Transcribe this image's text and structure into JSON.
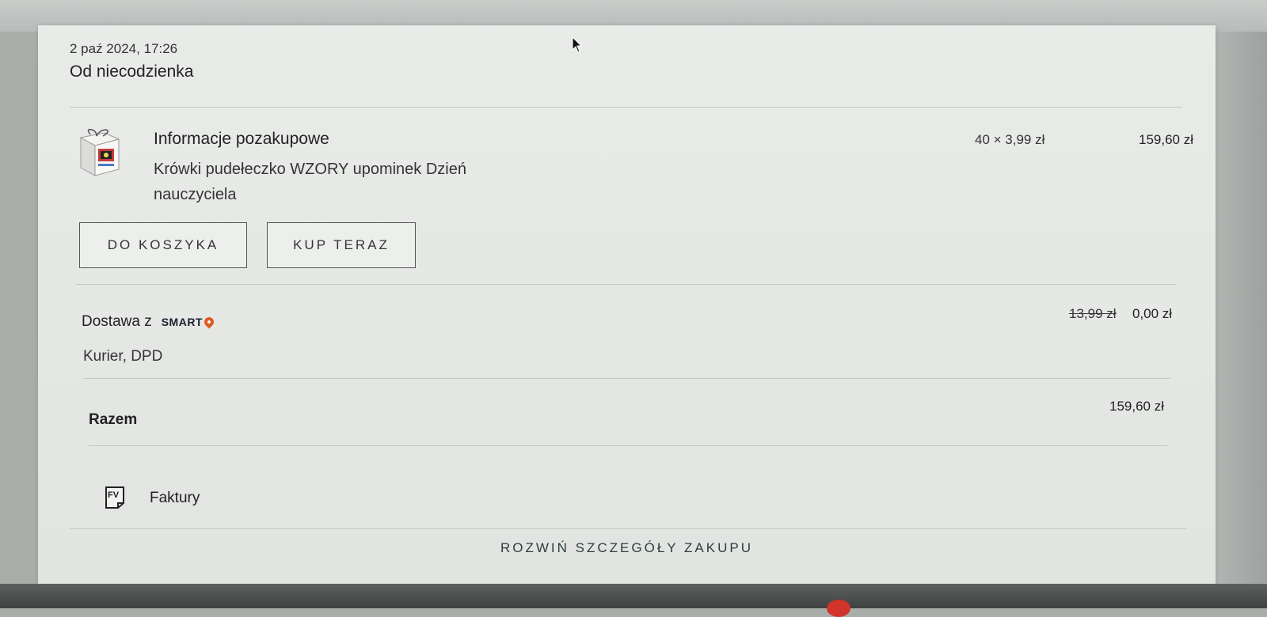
{
  "order": {
    "date": "2 paź 2024, 17:26",
    "seller": "Od niecodzienka"
  },
  "item": {
    "title": "Informacje pozakupowe",
    "description": "Krówki pudełeczko WZORY upominek Dzień nauczyciela",
    "quantity_price": "40 × 3,99 zł",
    "line_total": "159,60 zł"
  },
  "actions": {
    "add_to_cart": "DO KOSZYKA",
    "buy_now": "KUP TERAZ"
  },
  "delivery": {
    "label": "Dostawa z",
    "smart_logo": "SMART",
    "method": "Kurier, DPD",
    "old_price": "13,99 zł",
    "price": "0,00 zł"
  },
  "summary": {
    "total_label": "Razem",
    "total_value": "159,60 zł"
  },
  "invoices": {
    "icon_text": "FV",
    "label": "Faktury"
  },
  "footer": {
    "expand_label": "ROZWIŃ SZCZEGÓŁY ZAKUPU"
  },
  "colors": {
    "smart_accent": "#e05a1c",
    "card_background": "#e8eae8"
  },
  "icons": [
    "product-thumbnail",
    "smart-pin-icon",
    "invoice-fv-icon",
    "mouse-cursor"
  ]
}
